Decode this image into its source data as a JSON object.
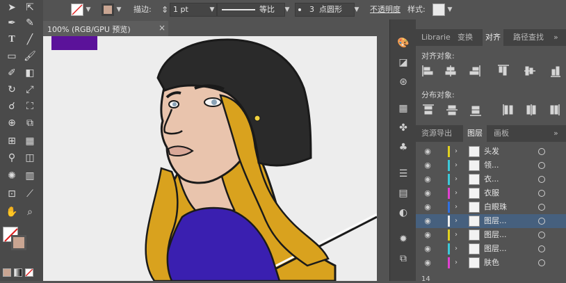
{
  "control_bar": {
    "stroke_label": "描边:",
    "stroke_weight": "1 pt",
    "profile_label": "等比",
    "brush_number": "3",
    "brush_label": "点圆形",
    "opacity_label": "不透明度",
    "style_label": "样式:"
  },
  "document": {
    "tab_label": "100% (RGB/GPU 预览)",
    "close_glyph": "×"
  },
  "panels": {
    "top_tabs": [
      "Librarie",
      "变换",
      "对齐",
      "路径查找"
    ],
    "top_tab_more": "»",
    "align_objects_label": "对齐对象:",
    "distribute_objects_label": "分布对象:",
    "bottom_tabs": [
      "资源导出",
      "图层",
      "画板"
    ],
    "bottom_tab_more": "»"
  },
  "layers": [
    {
      "name": "头发",
      "color": "#e0d020"
    },
    {
      "name": "领...",
      "color": "#3cc8d8"
    },
    {
      "name": "衣...",
      "color": "#3cc8d8"
    },
    {
      "name": "衣服",
      "color": "#e040d0"
    },
    {
      "name": "白眼珠",
      "color": "#3070e0"
    },
    {
      "name": "图层...",
      "color": "#f0f0f0"
    },
    {
      "name": "图层...",
      "color": "#e0d020"
    },
    {
      "name": "图层...",
      "color": "#3cc8d8"
    },
    {
      "name": "肤色",
      "color": "#e040d0"
    }
  ],
  "footer": {
    "layer_count": "14"
  },
  "colors": {
    "hair": "#d9a21e",
    "hat": "#2a2a2a",
    "skin": "#e9c4ad",
    "shirt": "#3a1fb0",
    "selected_row": "#46607e",
    "fill_swatch": "#c9a592"
  }
}
